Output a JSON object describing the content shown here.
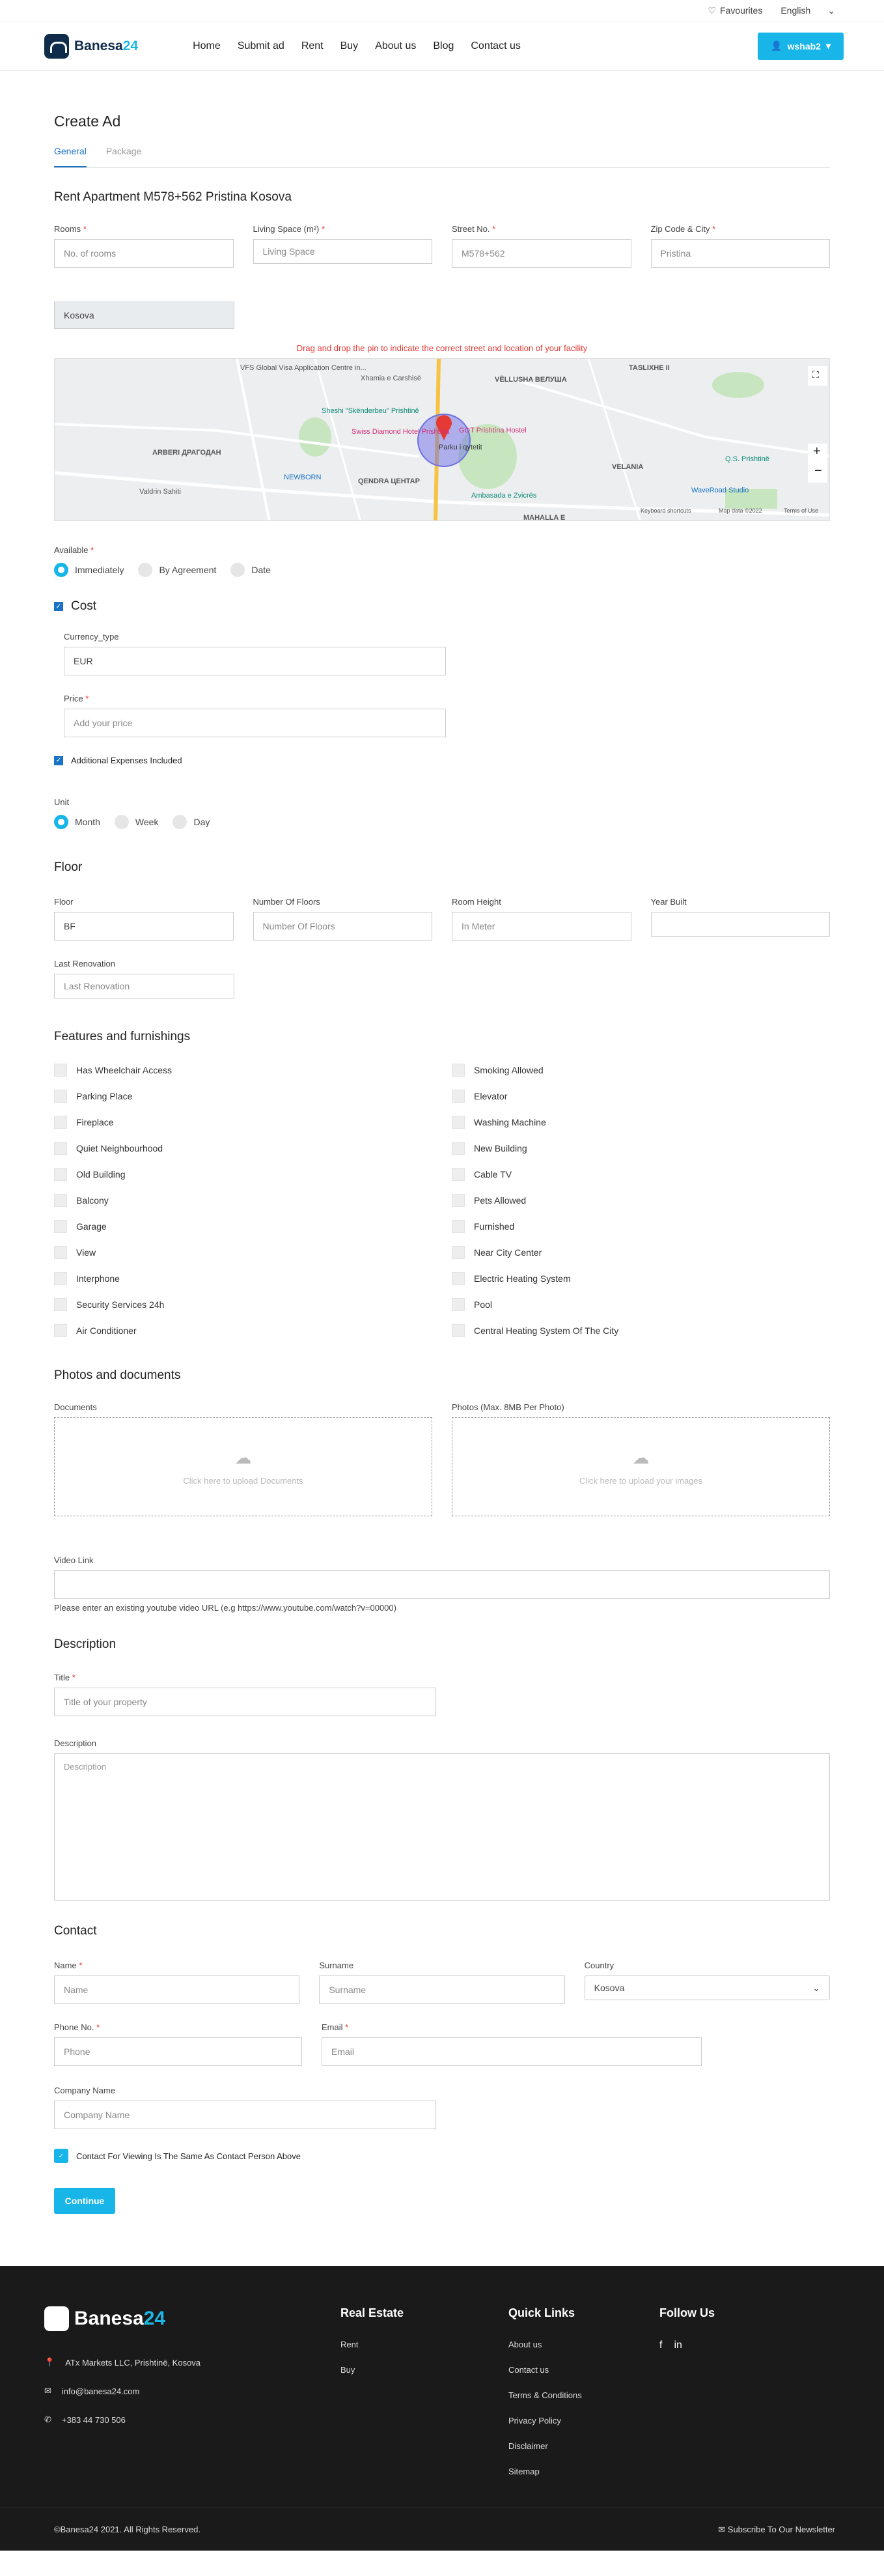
{
  "topbar": {
    "favourites": "Favourites",
    "language": "English"
  },
  "nav": {
    "logo_main": "Banesa",
    "logo_accent": "24",
    "menu": [
      "Home",
      "Submit ad",
      "Rent",
      "Buy",
      "About us",
      "Blog",
      "Contact us"
    ],
    "user": "wshab2"
  },
  "page": {
    "title": "Create Ad",
    "tabs": [
      "General",
      "Package"
    ],
    "ad_title": "Rent Apartment M578+562 Pristina Kosova"
  },
  "location": {
    "rooms_label": "Rooms",
    "rooms_placeholder": "No. of rooms",
    "space_label": "Living Space (m²)",
    "space_placeholder": "Living Space",
    "street_label": "Street No.",
    "street_value": "M578+562",
    "zip_label": "Zip Code & City",
    "zip_value": "Pristina",
    "country": "Kosova",
    "map_hint": "Drag and drop the pin to indicate the correct street and location of your facility",
    "map_labels": [
      "VFS Global Visa Application Centre in...",
      "Xhamia e Carshisë",
      "VËLLUSHA ВЕЛУША",
      "TASLIXHE II",
      "Sheshi \"Skënderbeu\" Prishtinë",
      "Swiss Diamond Hotel Prishtina",
      "GOT Prishtina Hostel",
      "Parku i qytetit",
      "ARBERI ДРАГОДАН",
      "NEWBORN",
      "QENDRA ЦЕНТАР",
      "VELANIA",
      "WaveRoad Studio",
      "Q.S. Prishtinë",
      "Ambasada e Zvicrës",
      "Valdrin Sahiti",
      "MAHALLA E",
      "Map data ©2022",
      "Keyboard shortcuts",
      "Terms of Use"
    ],
    "map_zoom_in": "+",
    "map_zoom_out": "−"
  },
  "available": {
    "label": "Available",
    "options": [
      "Immediately",
      "By Agreement",
      "Date"
    ]
  },
  "cost": {
    "heading": "Cost",
    "currency_label": "Currency_type",
    "currency_value": "EUR",
    "price_label": "Price",
    "price_placeholder": "Add your price",
    "extra_label": "Additional Expenses Included",
    "unit_label": "Unit",
    "units": [
      "Month",
      "Week",
      "Day"
    ]
  },
  "floor": {
    "heading": "Floor",
    "floor_label": "Floor",
    "floor_value": "BF",
    "floors_label": "Number Of Floors",
    "floors_placeholder": "Number Of Floors",
    "height_label": "Room Height",
    "height_placeholder": "In Meter",
    "year_label": "Year Built",
    "year_value": "",
    "renovation_label": "Last Renovation",
    "renovation_placeholder": "Last Renovation"
  },
  "features": {
    "heading": "Features and furnishings",
    "items": [
      "Has Wheelchair Access",
      "Smoking Allowed",
      "Parking Place",
      "Elevator",
      "Fireplace",
      "Washing Machine",
      "Quiet Neighbourhood",
      "New Building",
      "Old Building",
      "Cable TV",
      "Balcony",
      "Pets Allowed",
      "Garage",
      "Furnished",
      "View",
      "Near City Center",
      "Interphone",
      "Electric Heating System",
      "Security Services 24h",
      "Pool",
      "Air Conditioner",
      "Central Heating System Of The City"
    ]
  },
  "photos": {
    "heading": "Photos and documents",
    "docs_label": "Documents",
    "docs_hint": "Click here to upload Documents",
    "photos_label": "Photos (Max. 8MB Per Photo)",
    "photos_hint": "Click here to upload your images",
    "video_label": "Video Link",
    "video_hint": "Please enter an existing youtube video URL (e.g https://www.youtube.com/watch?v=00000)"
  },
  "description": {
    "heading": "Description",
    "title_label": "Title",
    "title_placeholder": "Title of your property",
    "desc_label": "Description",
    "desc_placeholder": "Description"
  },
  "contact": {
    "heading": "Contact",
    "name_label": "Name",
    "name_placeholder": "Name",
    "surname_label": "Surname",
    "surname_placeholder": "Surname",
    "country_label": "Country",
    "country_value": "Kosova",
    "phone_label": "Phone No.",
    "phone_placeholder": "Phone",
    "email_label": "Email",
    "email_placeholder": "Email",
    "company_label": "Company Name",
    "company_placeholder": "Company Name",
    "same_label": "Contact For Viewing Is The Same As Contact Person Above",
    "continue": "Continue"
  },
  "footer": {
    "address": "ATx Markets LLC, Prishtinë, Kosova",
    "email": "info@banesa24.com",
    "phone": "+383 44 730 506",
    "realestate_heading": "Real Estate",
    "realestate_links": [
      "Rent",
      "Buy"
    ],
    "quick_heading": "Quick Links",
    "quick_links": [
      "About us",
      "Contact us",
      "Terms & Conditions",
      "Privacy Policy",
      "Disclaimer",
      "Sitemap"
    ],
    "follow_heading": "Follow Us",
    "copyright": "©Banesa24 2021. All Rights Reserved.",
    "newsletter": "Subscribe To Our Newsletter"
  },
  "colors": {
    "accent": "#17b5e8",
    "brand": "#0f2c4a",
    "required": "#e53935",
    "tab_active": "#1a73c4"
  }
}
